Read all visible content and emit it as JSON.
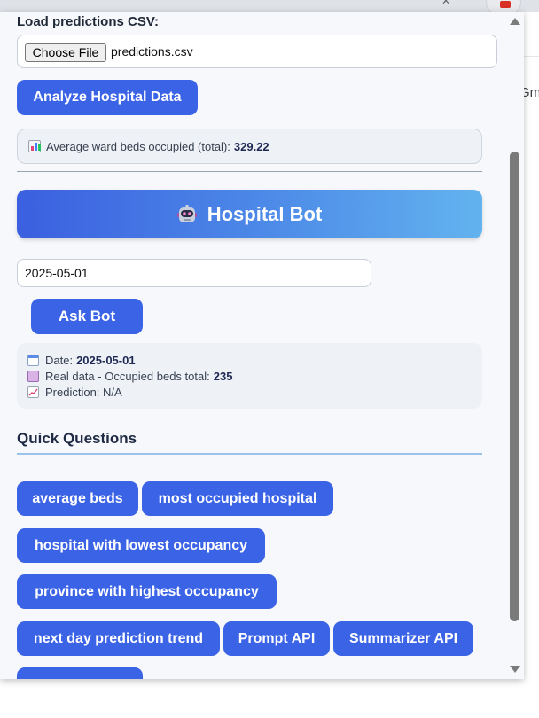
{
  "browser": {
    "behind_text": "Gm"
  },
  "load": {
    "label": "Load predictions CSV:",
    "file_button": "Choose File",
    "file_name": "predictions.csv"
  },
  "analyze_button": "Analyze Hospital Data",
  "average": {
    "label": "Average ward beds occupied (total):",
    "value": "329.22"
  },
  "bot": {
    "title": "Hospital Bot",
    "date_value": "2025-05-01",
    "ask_button": "Ask Bot"
  },
  "info": {
    "date_label": "Date:",
    "date_value": "2025-05-01",
    "real_label": "Real data - Occupied beds total:",
    "real_value": "235",
    "prediction_label": "Prediction: N/A"
  },
  "quick": {
    "title": "Quick Questions",
    "buttons": [
      "average beds",
      "most occupied hospital",
      "hospital with lowest occupancy",
      "province with highest occupancy",
      "next day prediction trend",
      "Prompt API",
      "Summarizer API"
    ]
  },
  "colors": {
    "accent": "#3b63e6",
    "banner_start": "#3b5fe0",
    "banner_end": "#63b3ef",
    "panel": "#eef1f5"
  },
  "icons": {
    "bar_chart": "bar-chart-icon",
    "robot": "robot-icon",
    "calendar": "calendar-icon",
    "clipboard": "clipboard-icon",
    "trend": "trend-chart-icon"
  }
}
